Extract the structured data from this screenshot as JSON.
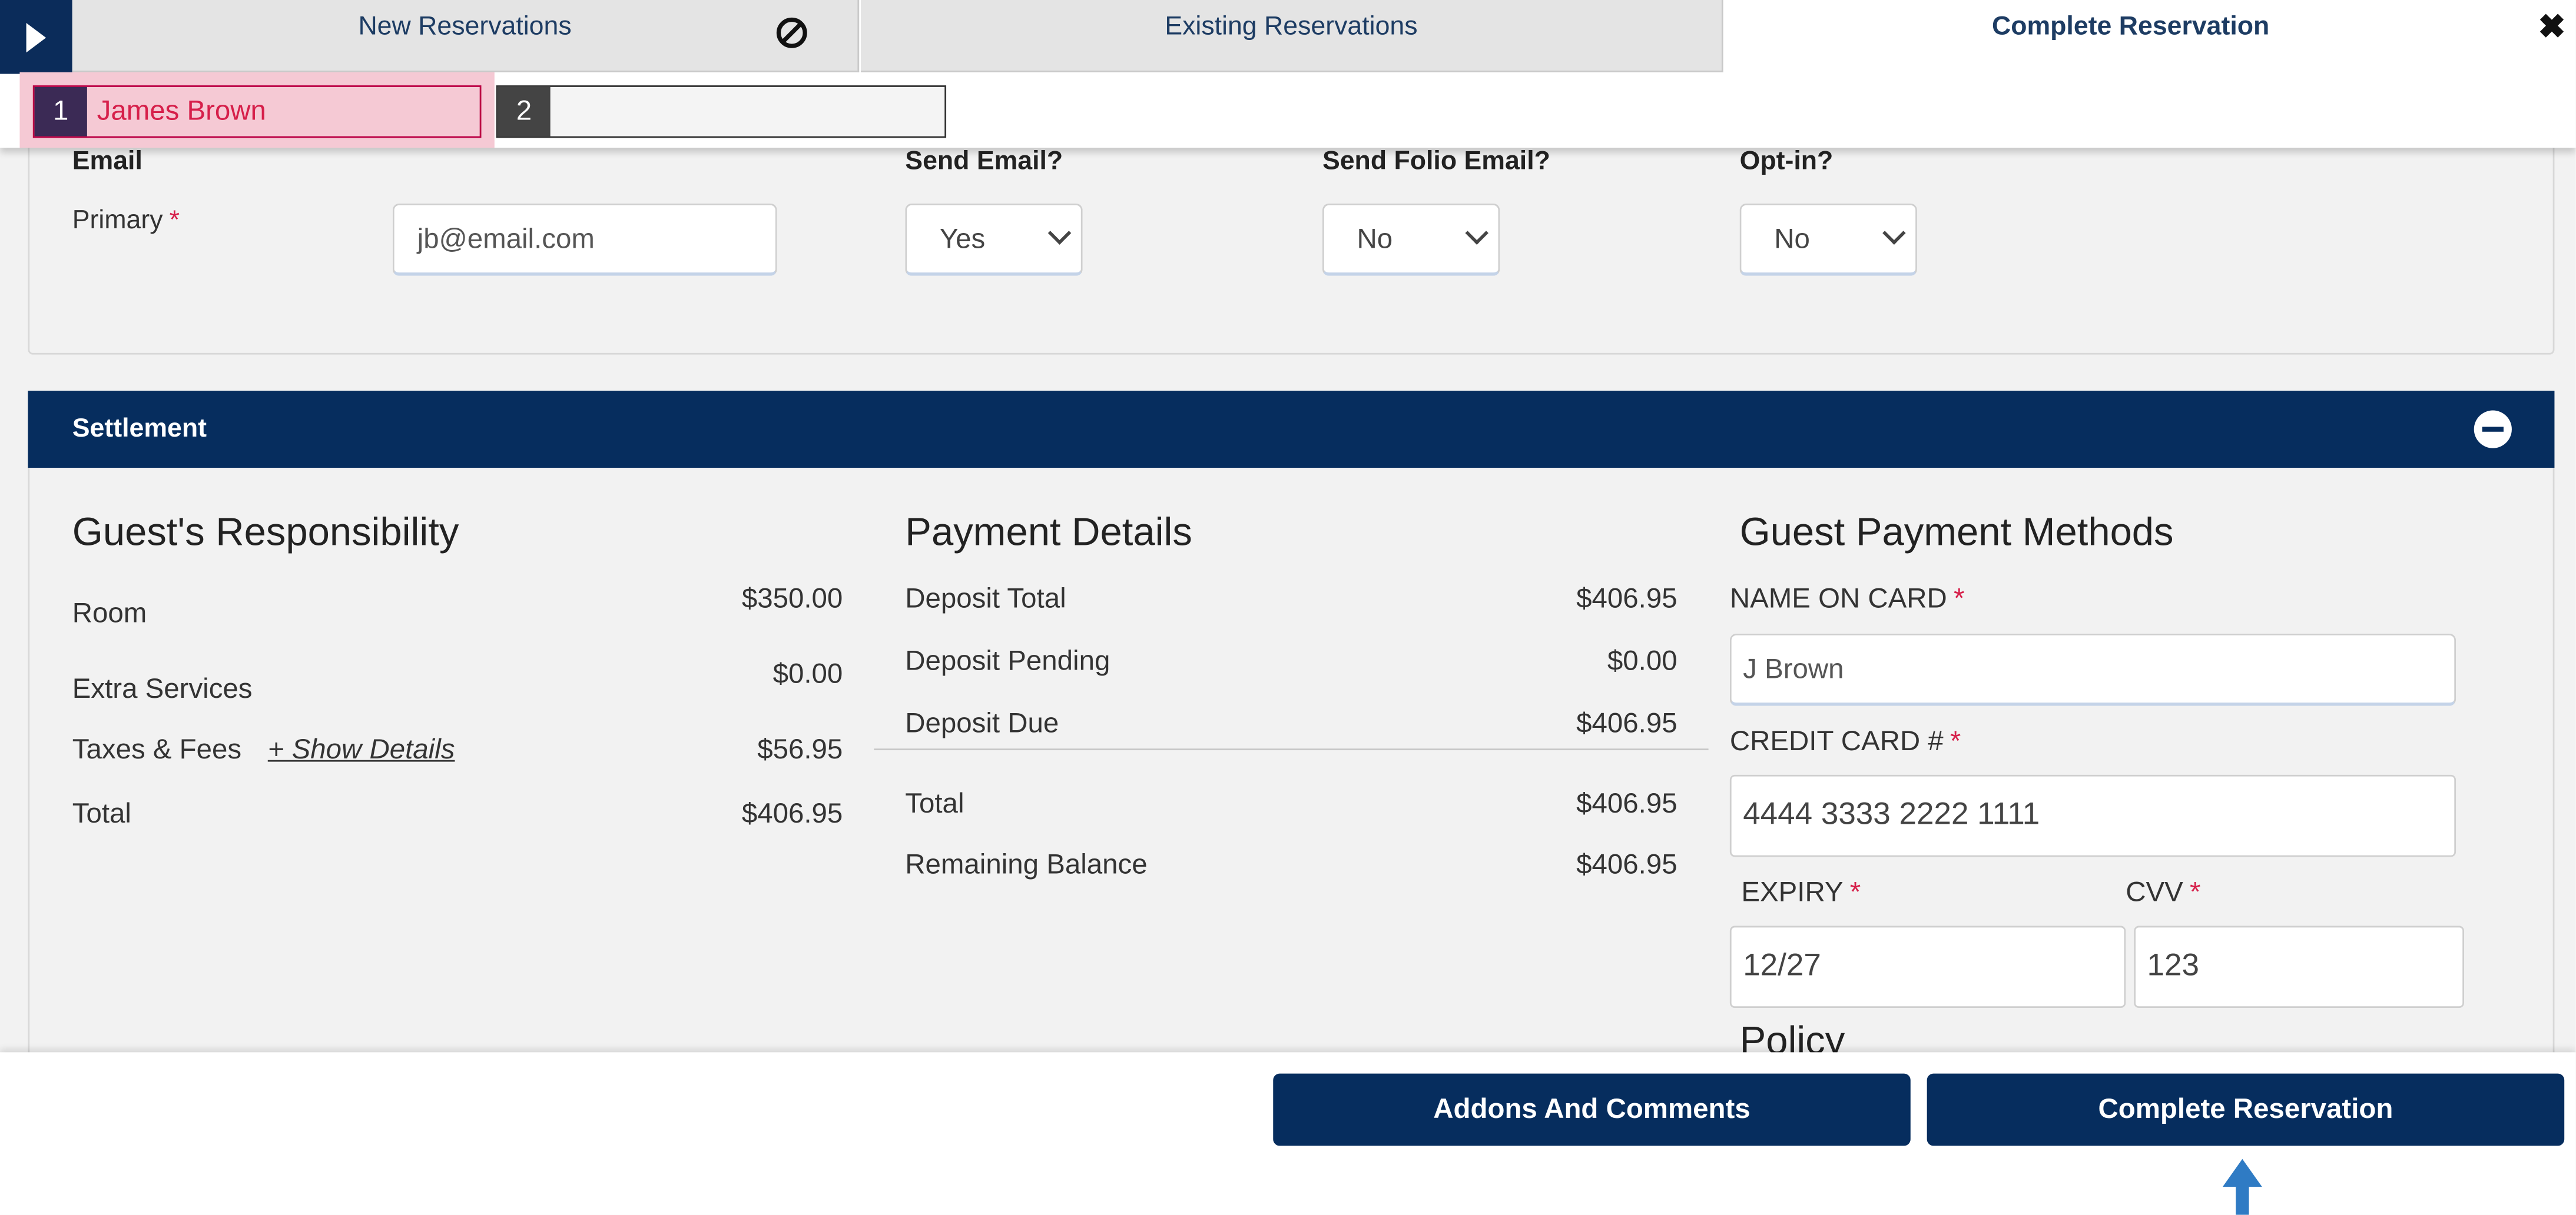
{
  "tabs": {
    "new": "New Reservations",
    "existing": "Existing Reservations",
    "complete": "Complete Reservation"
  },
  "guest_tabs": [
    {
      "number": "1",
      "name": "James Brown"
    },
    {
      "number": "2",
      "name": ""
    }
  ],
  "email": {
    "section_label": "Email",
    "primary_label": "Primary",
    "required_mark": "*",
    "primary_value": "jb@email.com",
    "send_email_label": "Send Email?",
    "send_email_value": "Yes",
    "send_folio_label": "Send Folio Email?",
    "send_folio_value": "No",
    "optin_label": "Opt-in?",
    "optin_value": "No"
  },
  "settlement": {
    "title": "Settlement",
    "guest_resp": {
      "title": "Guest's Responsibility",
      "room_label": "Room",
      "room_value": "$350.00",
      "extra_label": "Extra Services",
      "extra_value": "$0.00",
      "taxes_label": "Taxes & Fees",
      "show_details": "+ Show Details",
      "taxes_value": "$56.95",
      "total_label": "Total",
      "total_value": "$406.95"
    },
    "payment": {
      "title": "Payment Details",
      "deposit_total_label": "Deposit Total",
      "deposit_total_value": "$406.95",
      "deposit_pending_label": "Deposit Pending",
      "deposit_pending_value": "$0.00",
      "deposit_due_label": "Deposit Due",
      "deposit_due_value": "$406.95",
      "total_label": "Total",
      "total_value": "$406.95",
      "remaining_label": "Remaining Balance",
      "remaining_value": "$406.95"
    },
    "methods": {
      "title": "Guest Payment Methods",
      "name_label": "NAME ON CARD",
      "name_value": "J Brown",
      "cc_label": "CREDIT CARD #",
      "cc_value": "4444 3333 2222 1111",
      "expiry_label": "EXPIRY",
      "expiry_value": "12/27",
      "cvv_label": "CVV",
      "cvv_value": "123",
      "policy_title": "Policy"
    }
  },
  "buttons": {
    "addons": "Addons And Comments",
    "complete": "Complete Reservation"
  },
  "colors": {
    "navy": "#062d5e",
    "required": "#d61f4a",
    "selected_guest_bg": "#f5c9d4"
  }
}
